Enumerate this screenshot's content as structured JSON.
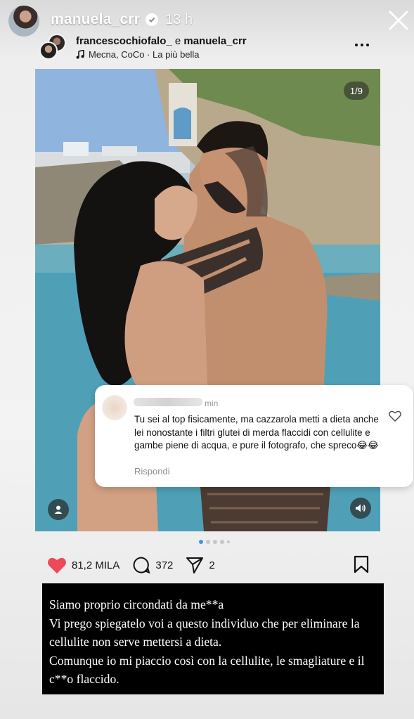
{
  "story": {
    "username": "manuela_crr",
    "time": "13 h"
  },
  "post": {
    "author1": "francescochiofalo_",
    "connector": " e ",
    "author2": "manuela_crr",
    "music": "Mecna, CoCo · La più bella",
    "counter": "1/9"
  },
  "comment": {
    "time": "min",
    "text": "Tu sei al top fisicamente,  ma cazzarola metti a dieta anche lei nonostante i filtri glutei di merda flaccidi con  cellulite e gambe piene di acqua, e pure il  fotografo,  che spreco😂😂",
    "reply_label": "Rispondi"
  },
  "actions": {
    "likes": "81,2 MILA",
    "comments": "372",
    "shares": "2"
  },
  "caption": {
    "text": "Siamo proprio circondati da me**a\nVi prego spiegatelo voi a questo individuo che per eliminare la cellulite non serve mettersi a dieta.\nComunque io mi piaccio così con la cellulite, le smagliature e il c**o flaccido."
  },
  "colors": {
    "like_red": "#ed4956",
    "dot_active": "#3897f0",
    "caption_bg": "#000000"
  }
}
